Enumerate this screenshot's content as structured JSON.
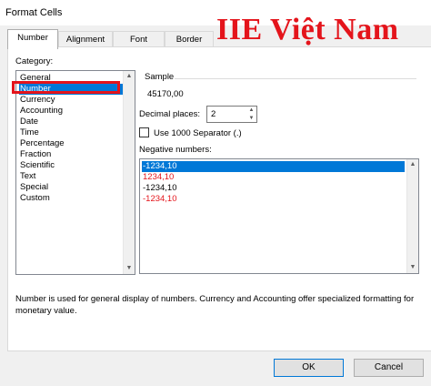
{
  "window": {
    "title": "Format Cells",
    "watermark": "IIE Việt Nam"
  },
  "tabs": [
    {
      "label": "Number",
      "active": true
    },
    {
      "label": "Alignment",
      "active": false
    },
    {
      "label": "Font",
      "active": false
    },
    {
      "label": "Border",
      "active": false
    }
  ],
  "category": {
    "label": "Category:",
    "items": [
      "General",
      "Number",
      "Currency",
      "Accounting",
      "Date",
      "Time",
      "Percentage",
      "Fraction",
      "Scientific",
      "Text",
      "Special",
      "Custom"
    ],
    "selected": "Number"
  },
  "sample": {
    "label": "Sample",
    "value": "45170,00"
  },
  "decimal_places": {
    "label": "Decimal places:",
    "value": "2"
  },
  "separator": {
    "label": "Use 1000 Separator (.)",
    "checked": false
  },
  "negative_numbers": {
    "label": "Negative numbers:",
    "items": [
      {
        "text": "-1234,10",
        "selected": true,
        "red": false
      },
      {
        "text": "1234,10",
        "selected": false,
        "red": true
      },
      {
        "text": "-1234,10",
        "selected": false,
        "red": false
      },
      {
        "text": "-1234,10",
        "selected": false,
        "red": true
      }
    ]
  },
  "description": "Number is used for general display of numbers.  Currency and Accounting offer specialized formatting for monetary value.",
  "buttons": {
    "ok": "OK",
    "cancel": "Cancel"
  },
  "colors": {
    "selection": "#0078d7",
    "highlight": "#e4141b",
    "negative_red": "#e4141b"
  }
}
